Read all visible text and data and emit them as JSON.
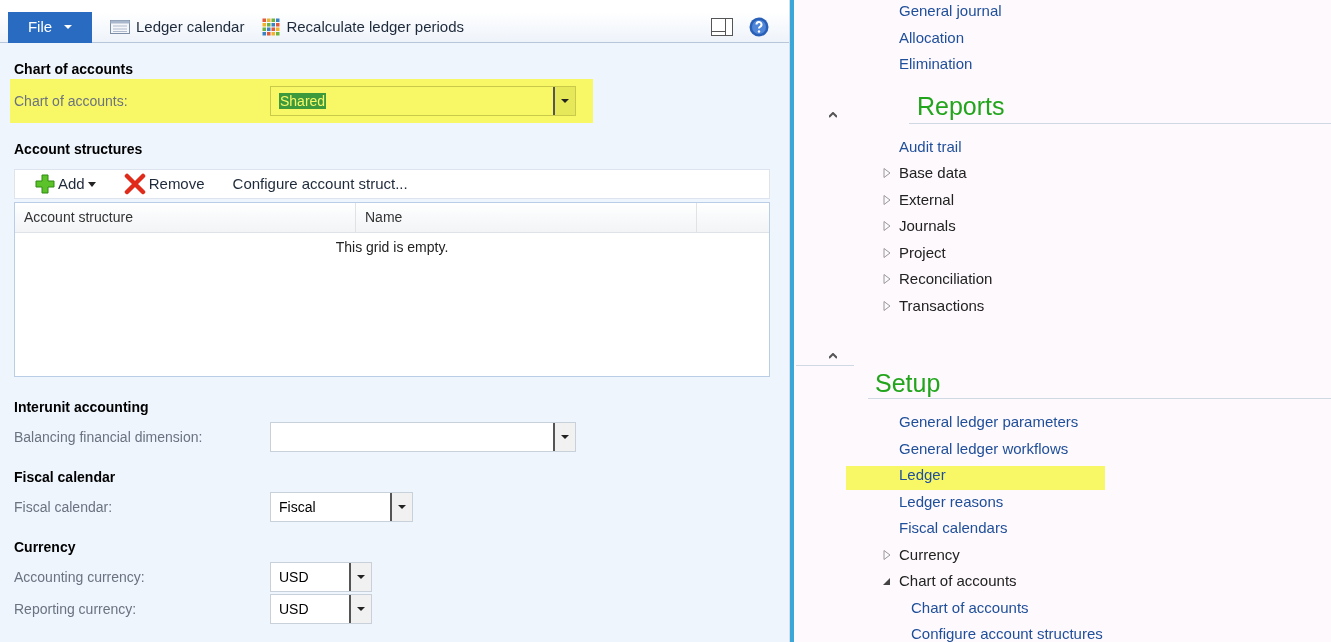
{
  "toolbar": {
    "file_button": "File",
    "actions": [
      {
        "label": "Ledger calendar",
        "kind": "calendar"
      },
      {
        "label": "Recalculate ledger periods",
        "kind": "grid"
      }
    ]
  },
  "form": {
    "sections": [
      {
        "kind": "fields",
        "title": "Chart of accounts",
        "highlighted": true,
        "fields": [
          {
            "label": "Chart of accounts:",
            "value": "Shared",
            "text_selected": true
          }
        ]
      },
      {
        "kind": "grid",
        "title": "Account structures",
        "actions": [
          {
            "label": "Add",
            "kind": "add"
          },
          {
            "label": "Remove",
            "kind": "remove"
          },
          {
            "label": "Configure account struct...",
            "kind": "text"
          }
        ],
        "columns": [
          "Account structure",
          "Name"
        ],
        "empty_message": "This grid is empty."
      },
      {
        "kind": "fields",
        "title": "Interunit accounting",
        "highlighted": false,
        "fields": [
          {
            "label": "Balancing financial dimension:"
          }
        ]
      },
      {
        "kind": "fields",
        "title": "Fiscal calendar",
        "highlighted": false,
        "fields": [
          {
            "label": "Fiscal calendar:",
            "value": "Fiscal"
          }
        ]
      },
      {
        "kind": "fields",
        "title": "Currency",
        "highlighted": false,
        "fields": [
          {
            "label": "Accounting currency:",
            "value": "USD"
          },
          {
            "label": "Reporting currency:",
            "value": "USD"
          }
        ]
      }
    ]
  },
  "navigation": {
    "groups": [
      {
        "items": [
          {
            "label": "General journal",
            "kind": "link",
            "highlighted": false
          },
          {
            "label": "Allocation",
            "kind": "link",
            "highlighted": false
          },
          {
            "label": "Elimination",
            "kind": "link",
            "highlighted": false
          }
        ]
      },
      {
        "title": "Reports",
        "expanded": true,
        "items": [
          {
            "label": "Audit trail",
            "kind": "link",
            "highlighted": false
          },
          {
            "label": "Base data",
            "kind": "folder",
            "expanded": false,
            "highlighted": false
          },
          {
            "label": "External",
            "kind": "folder",
            "expanded": false,
            "highlighted": false
          },
          {
            "label": "Journals",
            "kind": "folder",
            "expanded": false,
            "highlighted": false
          },
          {
            "label": "Project",
            "kind": "folder",
            "expanded": false,
            "highlighted": false
          },
          {
            "label": "Reconciliation",
            "kind": "folder",
            "expanded": false,
            "highlighted": false
          },
          {
            "label": "Transactions",
            "kind": "folder",
            "expanded": false,
            "highlighted": false
          }
        ]
      },
      {
        "title": "Setup",
        "expanded": true,
        "items": [
          {
            "label": "General ledger parameters",
            "kind": "link",
            "highlighted": false
          },
          {
            "label": "General ledger workflows",
            "kind": "link",
            "highlighted": false
          },
          {
            "label": "Ledger",
            "kind": "link",
            "highlighted": true
          },
          {
            "label": "Ledger reasons",
            "kind": "link",
            "highlighted": false
          },
          {
            "label": "Fiscal calendars",
            "kind": "link",
            "highlighted": false
          },
          {
            "label": "Currency",
            "kind": "folder",
            "expanded": false,
            "highlighted": false
          },
          {
            "label": "Chart of accounts",
            "kind": "folder",
            "expanded": true,
            "highlighted": false,
            "children": [
              {
                "label": "Chart of accounts",
                "kind": "link",
                "highlighted": false
              },
              {
                "label": "Configure account structures",
                "kind": "link",
                "highlighted": false
              }
            ]
          }
        ]
      }
    ]
  }
}
